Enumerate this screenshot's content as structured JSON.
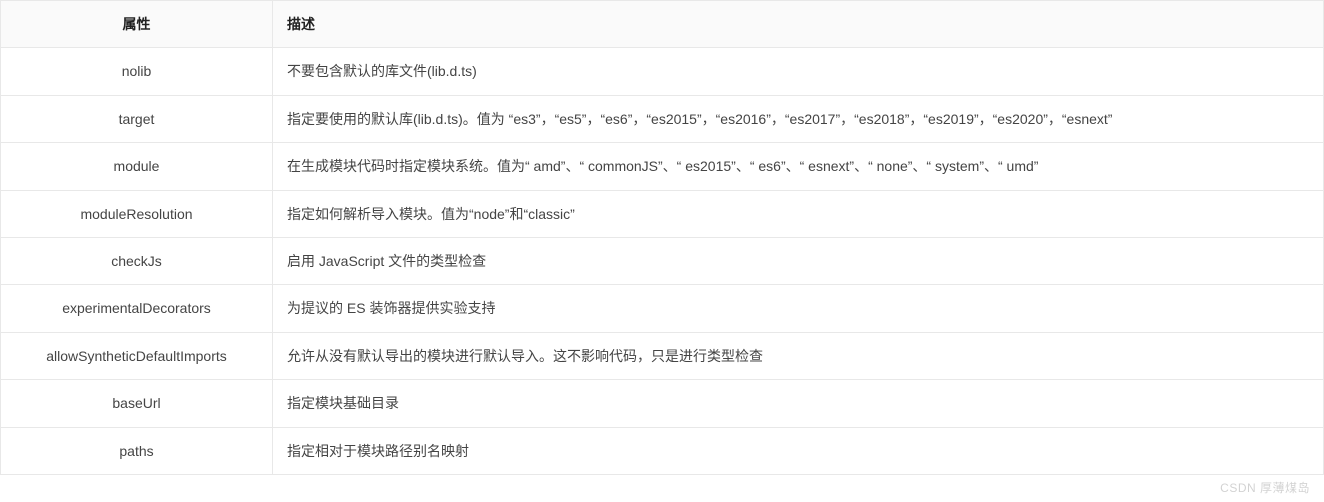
{
  "table": {
    "headers": {
      "attr": "属性",
      "desc": "描述"
    },
    "rows": [
      {
        "attr": "nolib",
        "desc": "不要包含默认的库文件(lib.d.ts)"
      },
      {
        "attr": "target",
        "desc": "指定要使用的默认库(lib.d.ts)。值为 “es3”，“es5”，“es6”，“es2015”，“es2016”，“es2017”，“es2018”，“es2019”，“es2020”，“esnext”"
      },
      {
        "attr": "module",
        "desc": "在生成模块代码时指定模块系统。值为“ amd”、“ commonJS”、“ es2015”、“ es6”、“ esnext”、“ none”、“ system”、“ umd”"
      },
      {
        "attr": "moduleResolution",
        "desc": "指定如何解析导入模块。值为“node”和“classic”"
      },
      {
        "attr": "checkJs",
        "desc": "启用 JavaScript 文件的类型检查"
      },
      {
        "attr": "experimentalDecorators",
        "desc": "为提议的 ES 装饰器提供实验支持"
      },
      {
        "attr": "allowSyntheticDefaultImports",
        "desc": "允许从没有默认导出的模块进行默认导入。这不影响代码，只是进行类型检查"
      },
      {
        "attr": "baseUrl",
        "desc": "指定模块基础目录"
      },
      {
        "attr": "paths",
        "desc": "指定相对于模块路径别名映射"
      }
    ]
  },
  "watermark": "CSDN 厚薄煤岛"
}
